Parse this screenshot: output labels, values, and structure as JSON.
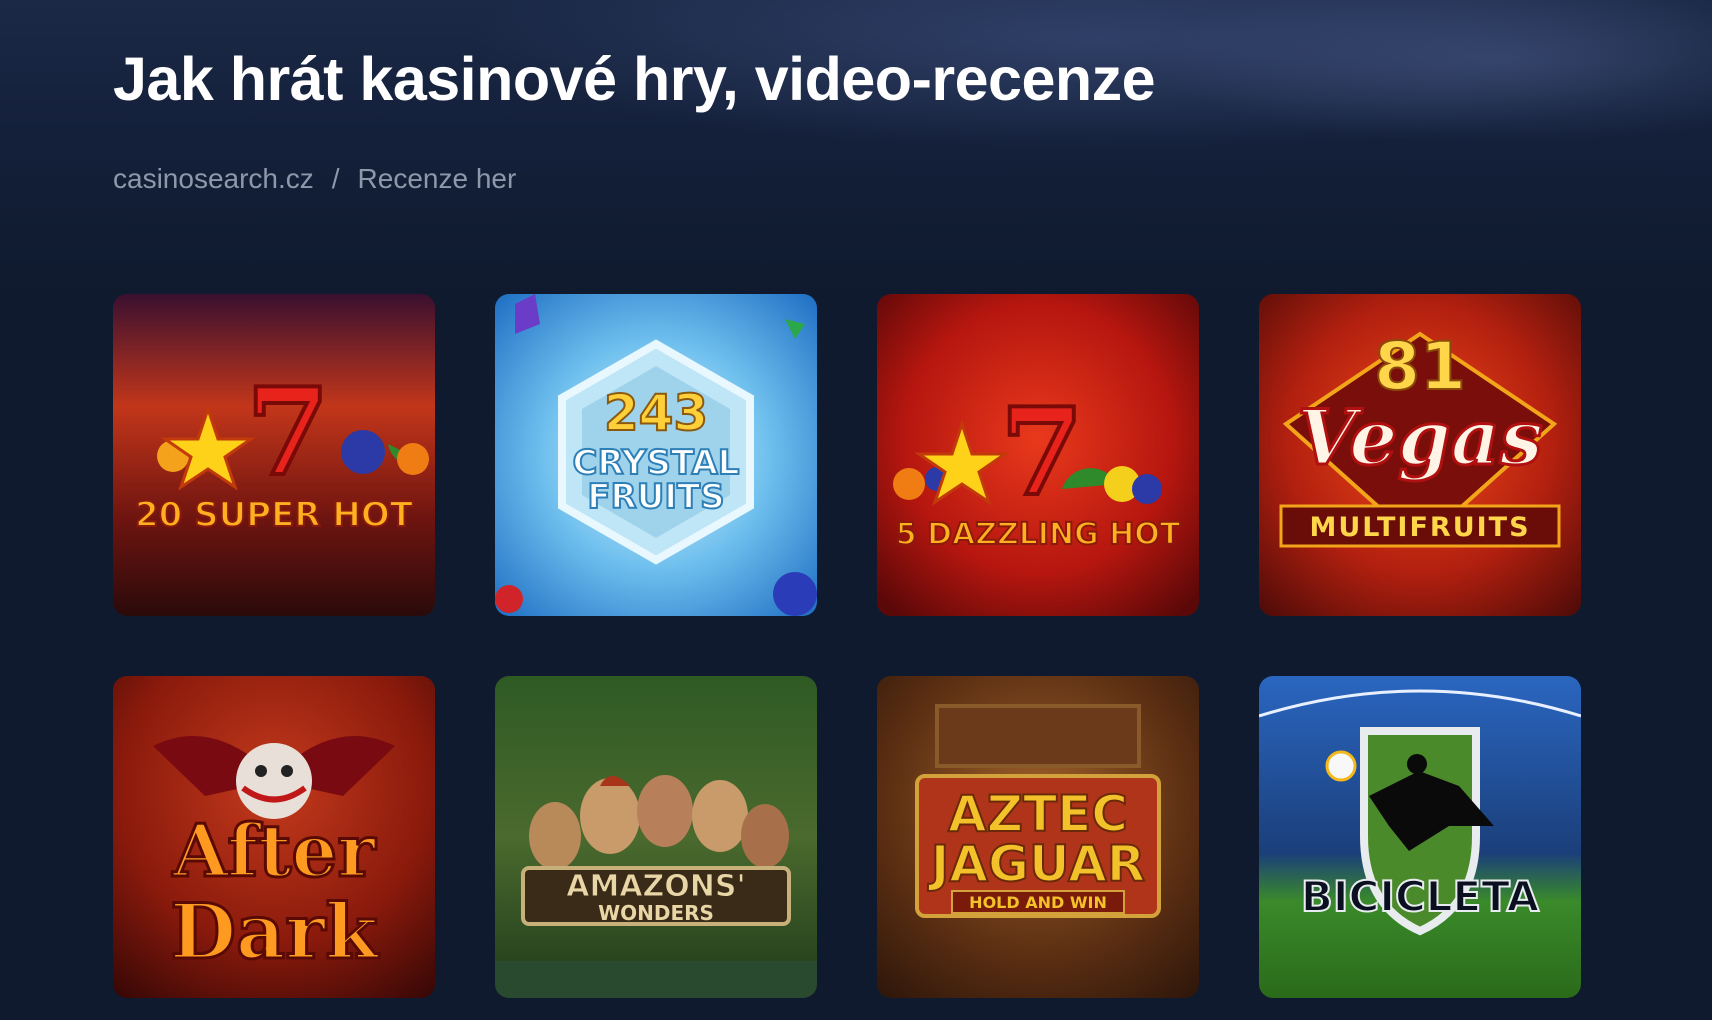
{
  "page": {
    "title": "Jak hrát kasinové hry, video-recenze"
  },
  "breadcrumb": {
    "home": "casinosearch.cz",
    "separator": "/",
    "current": "Recenze her"
  },
  "games": [
    {
      "title_line1": "20 SUPER HOT",
      "title_line2": "",
      "number": "7",
      "bg": "#5a1010",
      "accent": "#ffb020"
    },
    {
      "title_line1": "CRYSTAL",
      "title_line2": "FRUITS",
      "number": "243",
      "bg": "#2f8fd6",
      "accent": "#ffd24a"
    },
    {
      "title_line1": "5 DAZZLING HOT",
      "title_line2": "",
      "number": "7",
      "bg": "#a4120f",
      "accent": "#ffb020"
    },
    {
      "title_line1": "Vegas",
      "title_line2": "MULTIFRUITS",
      "number": "81",
      "bg": "#b0200f",
      "accent": "#ffd54a"
    },
    {
      "title_line1": "After",
      "title_line2": "Dark",
      "number": "",
      "bg": "#8a1a0c",
      "accent": "#ff9a20"
    },
    {
      "title_line1": "AMAZONS'",
      "title_line2": "WONDERS",
      "number": "",
      "bg": "#3d5a2a",
      "accent": "#e8d6a6"
    },
    {
      "title_line1": "AZTEC",
      "title_line2": "JAGUAR",
      "number": "HOLD AND WIN",
      "bg": "#5a2e12",
      "accent": "#f3c12a"
    },
    {
      "title_line1": "BICICLETA",
      "title_line2": "",
      "number": "",
      "bg": "#1b4f96",
      "accent": "#ffffff"
    }
  ]
}
